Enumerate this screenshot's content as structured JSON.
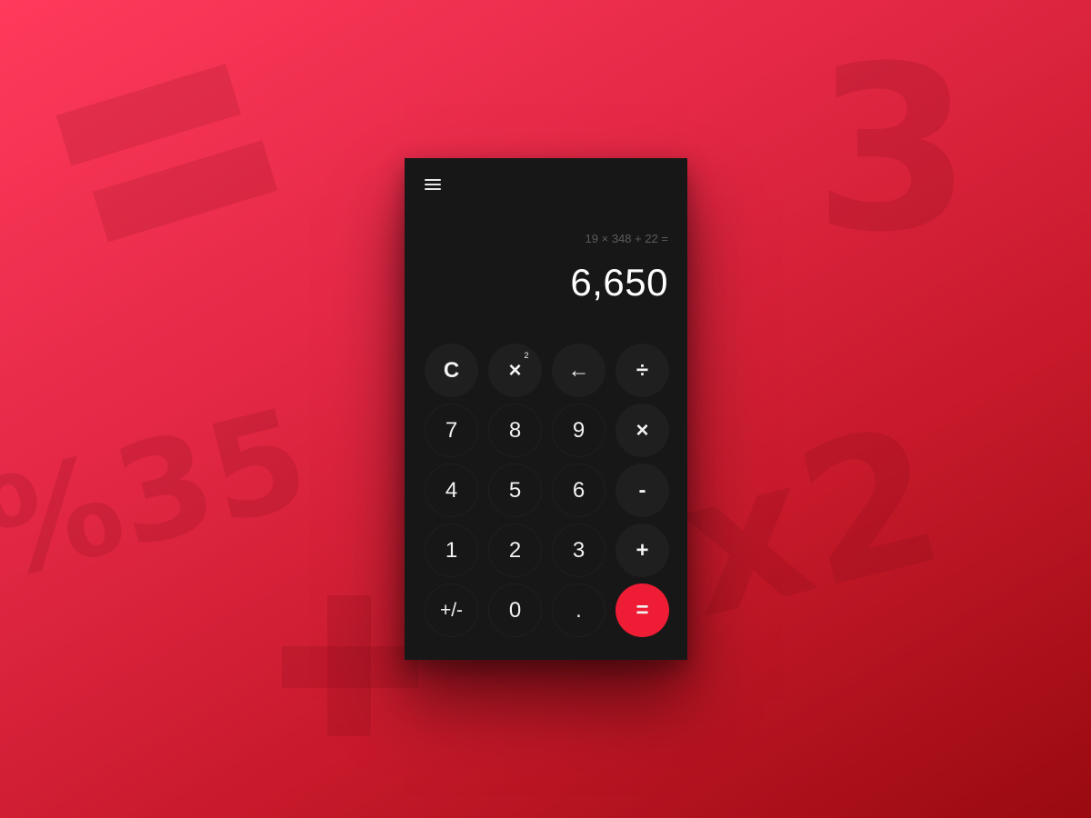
{
  "background": {
    "gradient_start": "#ff3a5c",
    "gradient_end": "#9a0a10",
    "glyphs": {
      "three": "3",
      "percent35": "%35",
      "x2": "x2"
    }
  },
  "calculator": {
    "panel_color": "#171717",
    "accent_color": "#ee1c34",
    "menu_icon": "hamburger-menu-icon",
    "expression": "19 × 348 + 22 =",
    "result": "6,650",
    "keys": {
      "clear": "C",
      "square_base": "×",
      "square_sup": "2",
      "backspace": "←",
      "divide": "÷",
      "seven": "7",
      "eight": "8",
      "nine": "9",
      "multiply": "×",
      "four": "4",
      "five": "5",
      "six": "6",
      "minus": "-",
      "one": "1",
      "two": "2",
      "three": "3",
      "plus": "+",
      "sign": "+/-",
      "zero": "0",
      "decimal": ".",
      "equals": "="
    }
  }
}
